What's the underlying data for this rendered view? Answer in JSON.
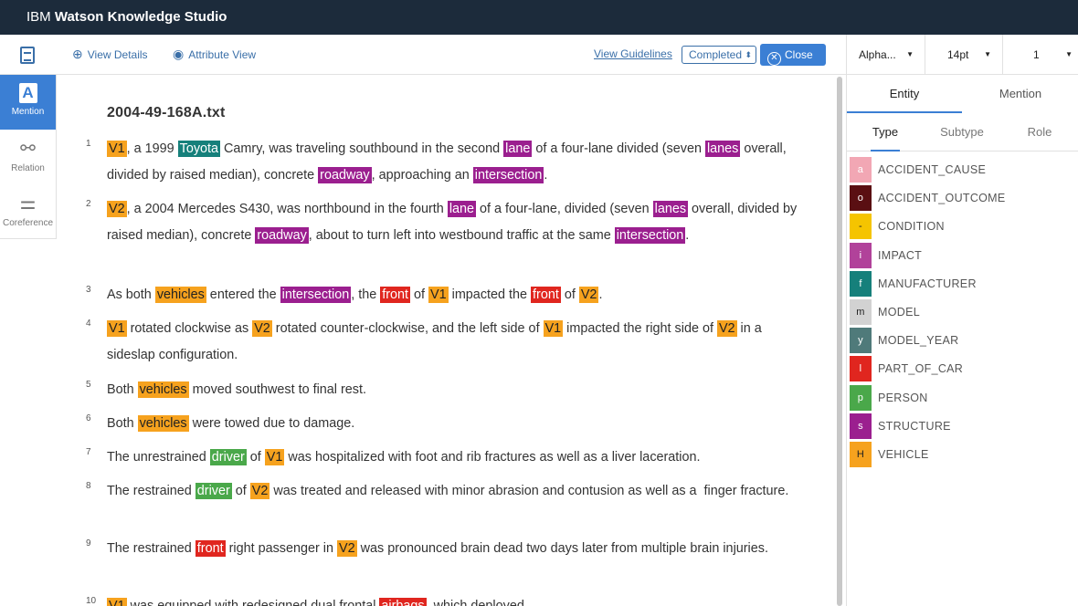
{
  "app": {
    "title_prefix": "IBM",
    "title_rest": "Watson Knowledge Studio"
  },
  "toolbar": {
    "view_details": "View Details",
    "attribute_view": "Attribute View",
    "view_guidelines": "View Guidelines",
    "status": "Completed",
    "close": "Close"
  },
  "leftnav": {
    "mention": "Mention",
    "relation": "Relation",
    "coreference": "Coreference"
  },
  "document": {
    "title": "2004-49-168A.txt",
    "sentences": [
      {
        "n": "1"
      },
      {
        "n": "2"
      },
      {
        "n": "3"
      },
      {
        "n": "4"
      },
      {
        "n": "5"
      },
      {
        "n": "6"
      },
      {
        "n": "7"
      },
      {
        "n": "8"
      },
      {
        "n": "9"
      },
      {
        "n": "10"
      }
    ]
  },
  "rightpanel": {
    "font_family": "Alpha...",
    "font_size": "14pt",
    "line_spacing": "1",
    "tabs": [
      "Entity",
      "Mention"
    ],
    "subtabs": [
      "Type",
      "Subtype",
      "Role"
    ],
    "types": [
      {
        "key": "a",
        "name": "ACCIDENT_CAUSE",
        "color": "#f2a7b4"
      },
      {
        "key": "o",
        "name": "ACCIDENT_OUTCOME",
        "color": "#5a0f12"
      },
      {
        "key": "-",
        "name": "CONDITION",
        "color": "#f5c400"
      },
      {
        "key": "i",
        "name": "IMPACT",
        "color": "#b1429a"
      },
      {
        "key": "f",
        "name": "MANUFACTURER",
        "color": "#16807b"
      },
      {
        "key": "m",
        "name": "MODEL",
        "color": "#d2d2d2"
      },
      {
        "key": "y",
        "name": "MODEL_YEAR",
        "color": "#4f7a7a"
      },
      {
        "key": "l",
        "name": "PART_OF_CAR",
        "color": "#e0261f"
      },
      {
        "key": "p",
        "name": "PERSON",
        "color": "#4aa84a"
      },
      {
        "key": "s",
        "name": "STRUCTURE",
        "color": "#9b1f8f"
      },
      {
        "key": "H",
        "name": "VEHICLE",
        "color": "#f6a21e"
      }
    ]
  }
}
